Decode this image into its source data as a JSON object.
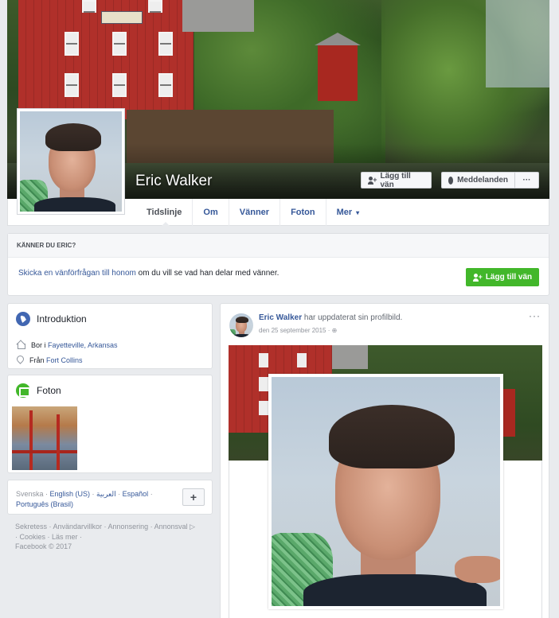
{
  "profile": {
    "name": "Eric Walker",
    "buttons": {
      "add_friend": "Lägg till vän",
      "message": "Meddelanden",
      "more": "···"
    }
  },
  "nav": {
    "tabs": [
      {
        "label": "Tidslinje"
      },
      {
        "label": "Om"
      },
      {
        "label": "Vänner"
      },
      {
        "label": "Foton"
      },
      {
        "label": "Mer"
      }
    ],
    "more_caret": "▾"
  },
  "know_card": {
    "title": "KÄNNER DU ERIC?",
    "link_text": "Skicka en vänförfrågan till honom",
    "rest_text": " om du vill se vad han delar med vänner.",
    "button": "Lägg till vän"
  },
  "intro": {
    "title": "Introduktion",
    "lives_prefix": "Bor i ",
    "lives_place": "Fayetteville, Arkansas",
    "from_prefix": "Från ",
    "from_place": "Fort Collins"
  },
  "photos": {
    "title": "Foton"
  },
  "languages": {
    "items": [
      "Svenska",
      "English (US)",
      "العربية",
      "Español",
      "Português (Brasil)"
    ],
    "current": "Svenska",
    "plus": "+"
  },
  "footer": {
    "line1": "Sekretess · Användarvillkor · Annonsering · Annonsval",
    "line2": "· Cookies · Läs mer ·",
    "line3": "Facebook © 2017"
  },
  "post": {
    "author": "Eric Walker",
    "action": " har uppdaterat sin profilbild.",
    "date": "den 25 september 2015 ·",
    "menu": "···"
  },
  "colors": {
    "accent": "#4267b2",
    "link": "#365899",
    "green": "#42b72a",
    "background": "#e9ebee"
  }
}
